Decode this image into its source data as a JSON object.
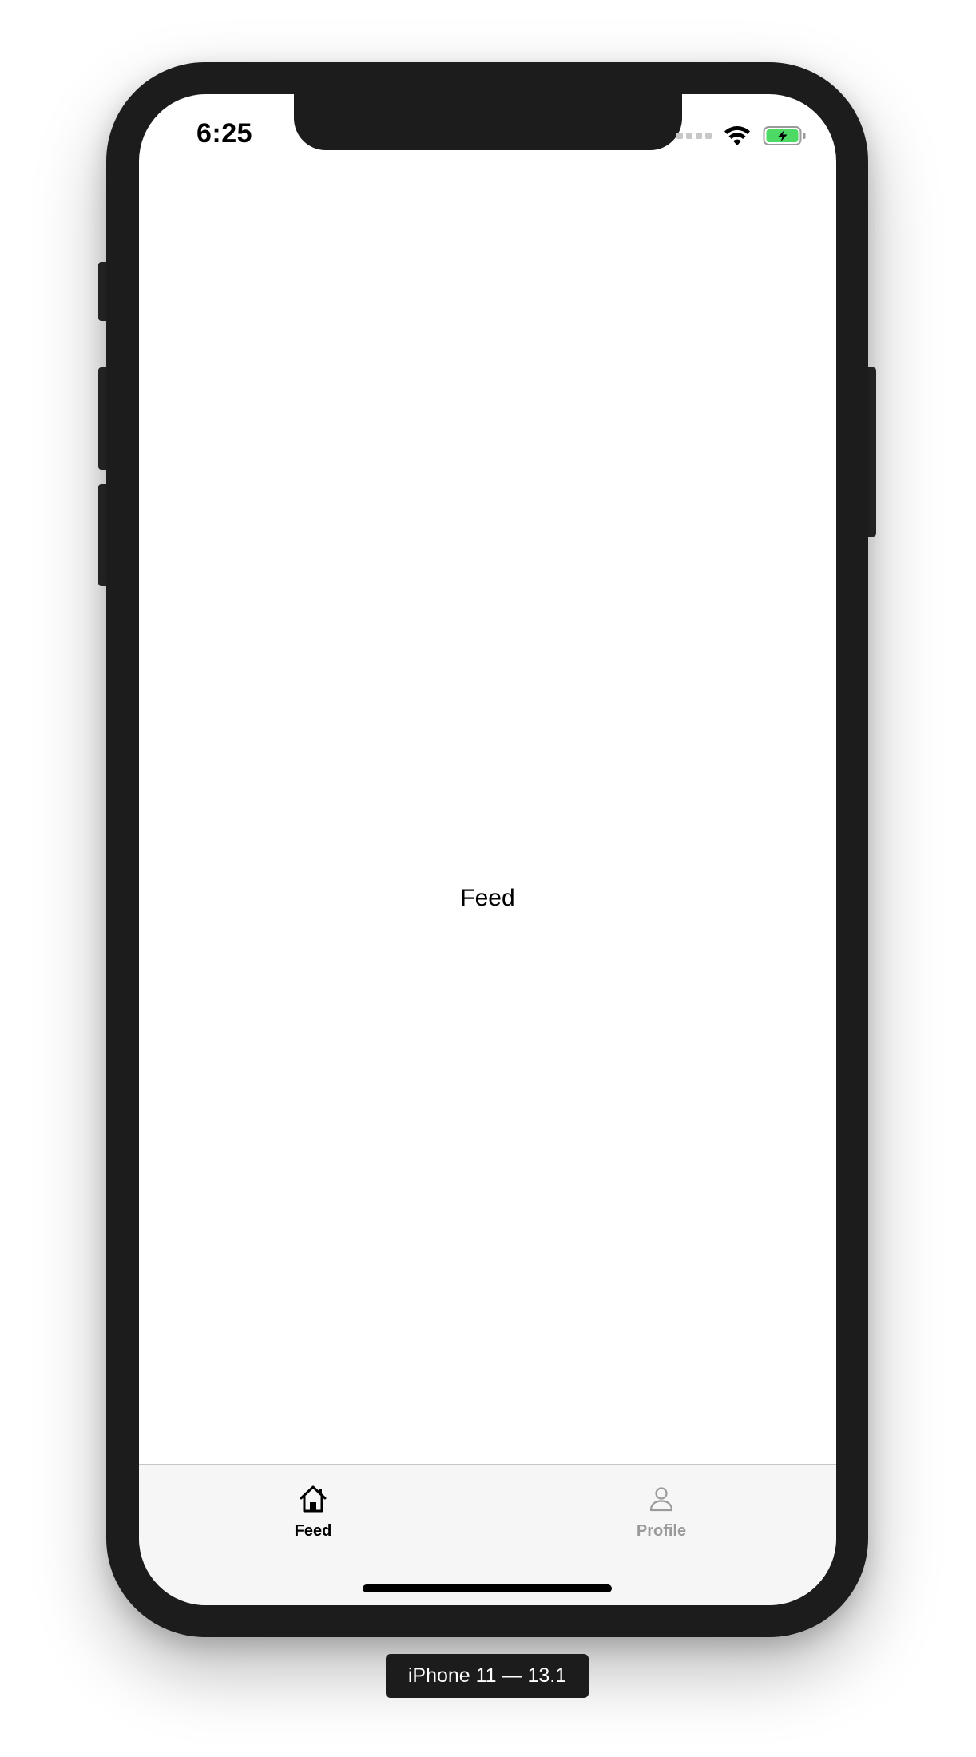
{
  "status_bar": {
    "time": "6:25",
    "signal_icon": "signal-dots-icon",
    "wifi_icon": "wifi-icon",
    "battery_icon": "battery-charging-icon",
    "battery_color": "#4cd964"
  },
  "content": {
    "center_text": "Feed"
  },
  "tab_bar": {
    "tabs": [
      {
        "label": "Feed",
        "icon": "home-icon",
        "active": true,
        "color": "#000000"
      },
      {
        "label": "Profile",
        "icon": "person-icon",
        "active": false,
        "color": "#9a9a9a"
      }
    ]
  },
  "device_badge": {
    "label": "iPhone 11 — 13.1"
  }
}
